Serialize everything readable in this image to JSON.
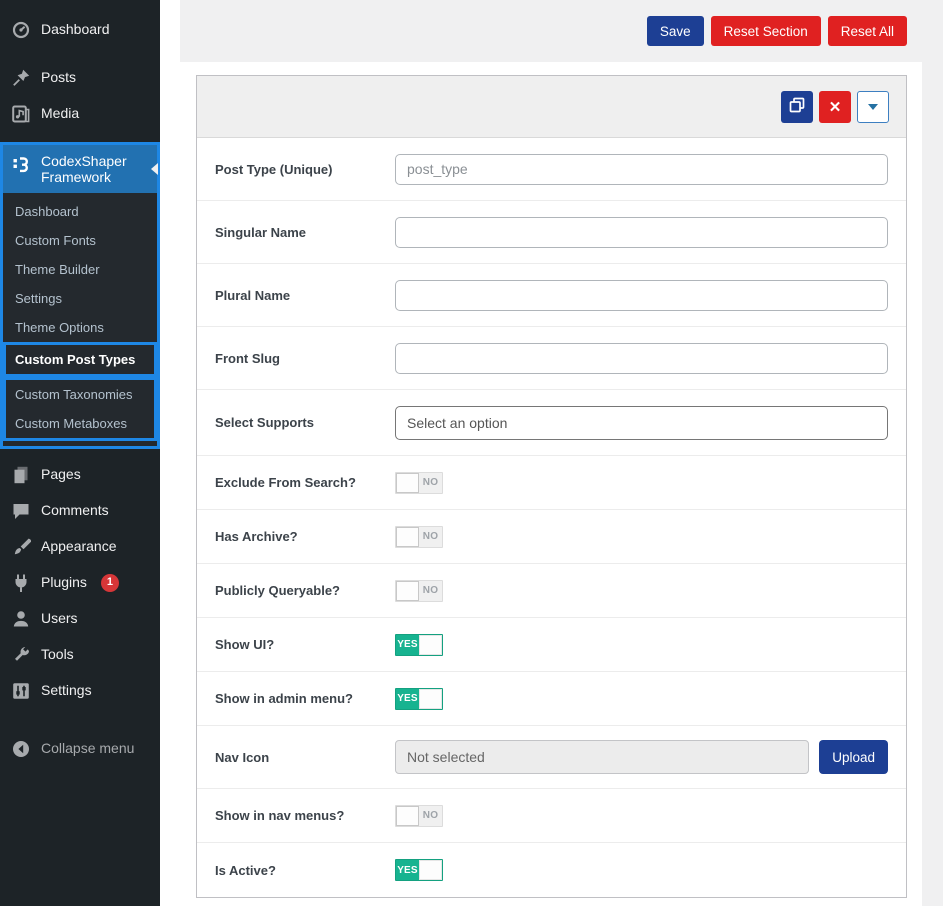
{
  "sidebar": {
    "items": [
      {
        "label": "Dashboard",
        "icon": "dashboard-icon",
        "section": "top"
      },
      {
        "label": "Posts",
        "icon": "pin-icon",
        "section": "top2"
      },
      {
        "label": "Media",
        "icon": "media-icon",
        "section": "top2"
      },
      {
        "label": "CodexShaper Framework",
        "icon": "codexshaper-logo-icon",
        "section": "framework",
        "active": true
      },
      {
        "label": "Pages",
        "icon": "pages-icon",
        "section": "bottom"
      },
      {
        "label": "Comments",
        "icon": "comment-icon",
        "section": "bottom"
      },
      {
        "label": "Appearance",
        "icon": "brush-icon",
        "section": "bottom"
      },
      {
        "label": "Plugins",
        "icon": "plugin-icon",
        "section": "bottom",
        "badge": "1"
      },
      {
        "label": "Users",
        "icon": "user-icon",
        "section": "bottom"
      },
      {
        "label": "Tools",
        "icon": "wrench-icon",
        "section": "bottom"
      },
      {
        "label": "Settings",
        "icon": "sliders-icon",
        "section": "bottom"
      },
      {
        "label": "Collapse menu",
        "icon": "collapse-icon",
        "section": "footer",
        "muted": true
      }
    ],
    "submenu": [
      {
        "label": "Dashboard"
      },
      {
        "label": "Custom Fonts"
      },
      {
        "label": "Theme Builder"
      },
      {
        "label": "Settings"
      },
      {
        "label": "Theme Options"
      },
      {
        "label": "Custom Post Types",
        "active": true,
        "box": "solo"
      },
      {
        "label": "Custom Taxonomies",
        "box": "pair"
      },
      {
        "label": "Custom Metaboxes",
        "box": "pair"
      }
    ]
  },
  "toolbar": {
    "save_label": "Save",
    "reset_section_label": "Reset Section",
    "reset_all_label": "Reset All"
  },
  "panel": {
    "header_buttons": [
      {
        "name": "clone-button",
        "icon": "clone-icon"
      },
      {
        "name": "delete-button",
        "icon": "close-icon"
      },
      {
        "name": "collapse-button",
        "icon": "chevron-down-icon"
      }
    ],
    "toggle_on_label": "YES",
    "toggle_off_label": "NO",
    "rows": [
      {
        "label": "Post Type (Unique)",
        "type": "text",
        "value": "",
        "placeholder": "post_type"
      },
      {
        "label": "Singular Name",
        "type": "text",
        "value": "",
        "placeholder": ""
      },
      {
        "label": "Plural Name",
        "type": "text",
        "value": "",
        "placeholder": ""
      },
      {
        "label": "Front Slug",
        "type": "text",
        "value": "",
        "placeholder": ""
      },
      {
        "label": "Select Supports",
        "type": "select",
        "value": "Select an option"
      },
      {
        "label": "Exclude From Search?",
        "type": "toggle",
        "state": "no"
      },
      {
        "label": "Has Archive?",
        "type": "toggle",
        "state": "no"
      },
      {
        "label": "Publicly Queryable?",
        "type": "toggle",
        "state": "no"
      },
      {
        "label": "Show UI?",
        "type": "toggle",
        "state": "yes"
      },
      {
        "label": "Show in admin menu?",
        "type": "toggle",
        "state": "yes"
      },
      {
        "label": "Nav Icon",
        "type": "upload",
        "value": "Not selected",
        "button_label": "Upload"
      },
      {
        "label": "Show in nav menus?",
        "type": "toggle",
        "state": "no"
      },
      {
        "label": "Is Active?",
        "type": "toggle",
        "state": "yes"
      }
    ]
  },
  "colors": {
    "sidebar_bg": "#1d2327",
    "active_menu_bg": "#2271b1",
    "highlight_border": "#1e87e5",
    "primary_button": "#1d3f94",
    "danger_button": "#e02121",
    "toggle_on": "#17b390",
    "badge": "#d63638"
  }
}
